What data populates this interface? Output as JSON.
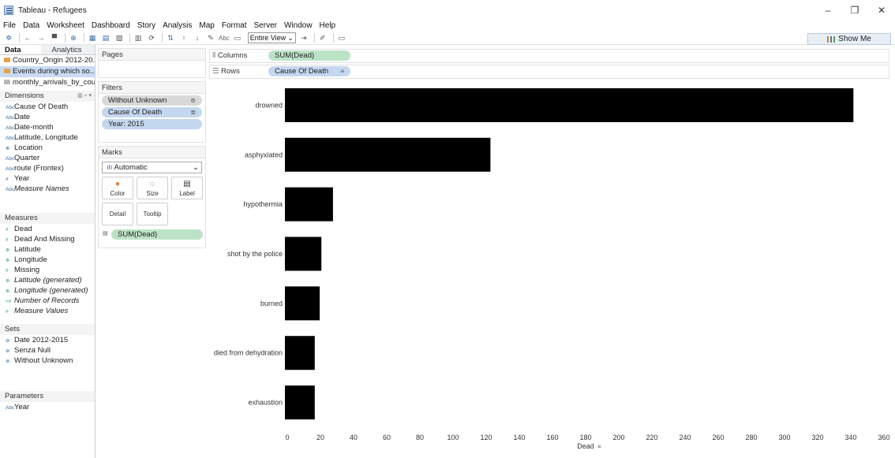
{
  "window": {
    "title": "Tableau - Refugees",
    "minimize": "–",
    "maximize": "❐",
    "close": "✕"
  },
  "menu": [
    "File",
    "Data",
    "Worksheet",
    "Dashboard",
    "Story",
    "Analysis",
    "Map",
    "Format",
    "Server",
    "Window",
    "Help"
  ],
  "toolbar": {
    "view_mode": "Entire View",
    "abc_label": "Abc",
    "show_me": "Show Me"
  },
  "data_pane": {
    "tabs": [
      "Data",
      "Analytics"
    ],
    "datasources": [
      {
        "label": "Country_Origin 2012-20...",
        "active": false
      },
      {
        "label": "Events during which so...",
        "active": true
      },
      {
        "label": "monthly_arrivals_by_cou...",
        "active": false
      }
    ],
    "dimensions_header": "Dimensions",
    "dimensions": [
      {
        "icon": "Abc",
        "label": "Cause Of Death",
        "italic": false
      },
      {
        "icon": "Abc",
        "label": "Date",
        "italic": false
      },
      {
        "icon": "Abc",
        "label": "Date-month",
        "italic": false
      },
      {
        "icon": "Abc",
        "label": "Latitude, Longitude",
        "italic": false
      },
      {
        "icon": "⊕",
        "label": "Location",
        "italic": false
      },
      {
        "icon": "Abc",
        "label": "Quarter",
        "italic": false
      },
      {
        "icon": "Abc",
        "label": "route (Frontex)",
        "italic": false
      },
      {
        "icon": "#",
        "label": "Year",
        "italic": false
      },
      {
        "icon": "Abc",
        "label": "Measure Names",
        "italic": true
      }
    ],
    "measures_header": "Measures",
    "measures": [
      {
        "icon": "#",
        "label": "Dead",
        "italic": false
      },
      {
        "icon": "#",
        "label": "Dead And Missing",
        "italic": false
      },
      {
        "icon": "⊕",
        "label": "Latitude",
        "italic": false
      },
      {
        "icon": "⊕",
        "label": "Longitude",
        "italic": false
      },
      {
        "icon": "#",
        "label": "Missing",
        "italic": false
      },
      {
        "icon": "⊕",
        "label": "Latitude (generated)",
        "italic": true
      },
      {
        "icon": "⊕",
        "label": "Longitude (generated)",
        "italic": true
      },
      {
        "icon": "=#",
        "label": "Number of Records",
        "italic": true
      },
      {
        "icon": "#",
        "label": "Measure Values",
        "italic": true
      }
    ],
    "sets_header": "Sets",
    "sets": [
      {
        "icon": "⊚",
        "label": "Date 2012-2015"
      },
      {
        "icon": "⊚",
        "label": "Senza Null"
      },
      {
        "icon": "⊚",
        "label": "Without Unknown"
      }
    ],
    "parameters_header": "Parameters",
    "parameters": [
      {
        "icon": "Abc",
        "label": "Year"
      }
    ]
  },
  "cards": {
    "pages_title": "Pages",
    "filters_title": "Filters",
    "filters": [
      {
        "label": "Without Unknown",
        "style": "grey",
        "icon": "⊚"
      },
      {
        "label": "Cause Of Death",
        "style": "blue",
        "icon": "≣"
      },
      {
        "label": "Year: 2015",
        "style": "blue",
        "icon": ""
      }
    ],
    "marks_title": "Marks",
    "mark_type": "Automatic",
    "mark_buttons": [
      "Color",
      "Size",
      "Label",
      "Detail",
      "Tooltip"
    ],
    "mark_pill": "SUM(Dead)"
  },
  "shelves": {
    "columns_label": "Columns",
    "columns_pill": "SUM(Dead)",
    "rows_label": "Rows",
    "rows_pill": "Cause Of Death"
  },
  "chart_data": {
    "type": "bar",
    "orientation": "horizontal",
    "categories": [
      "drowned",
      "asphyxiated",
      "hypothermia",
      "shot by the police",
      "burned",
      "died from dehydration",
      "exhaustion"
    ],
    "values": [
      343,
      124,
      29,
      22,
      21,
      18,
      18
    ],
    "xlabel": "Dead",
    "ylabel": "",
    "xlim": [
      0,
      360
    ],
    "xticks": [
      0,
      20,
      40,
      60,
      80,
      100,
      120,
      140,
      160,
      180,
      200,
      220,
      240,
      260,
      280,
      300,
      320,
      340,
      360
    ],
    "bar_color": "#000000",
    "grid": false
  }
}
